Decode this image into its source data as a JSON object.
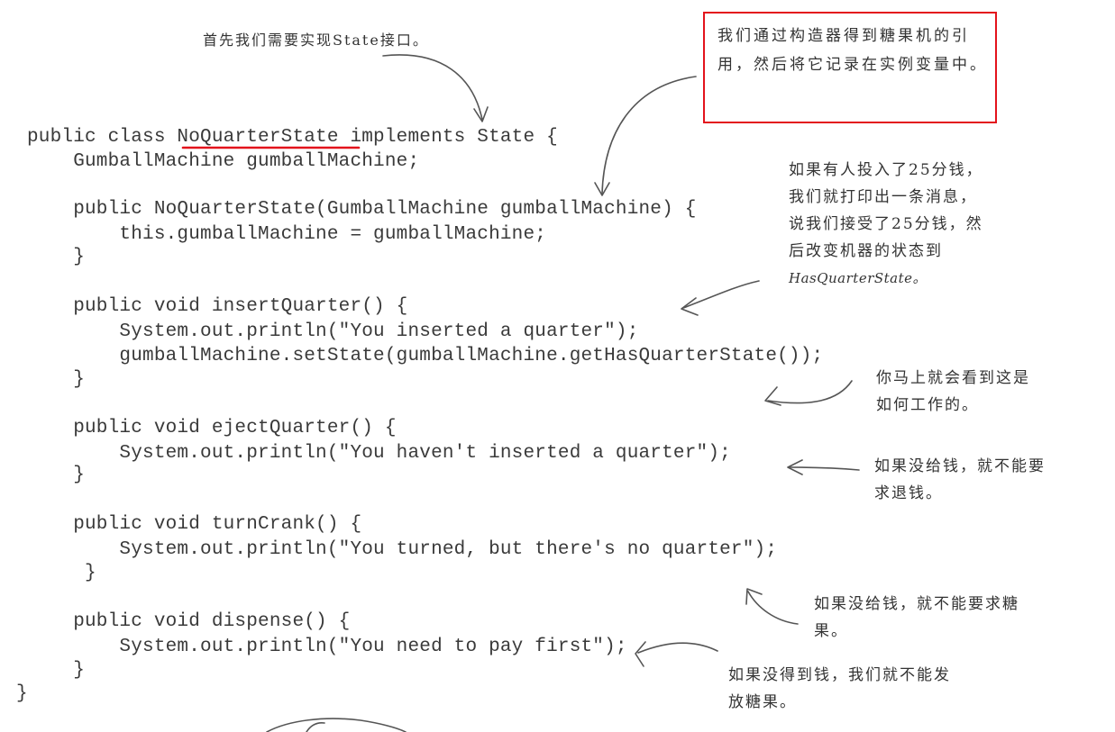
{
  "code": {
    "lines": [
      "public class NoQuarterState implements State {",
      "    GumballMachine gumballMachine;",
      "    public NoQuarterState(GumballMachine gumballMachine) {",
      "        this.gumballMachine = gumballMachine;",
      "    }",
      "    public void insertQuarter() {",
      "        System.out.println(\"You inserted a quarter\");",
      "        gumballMachine.setState(gumballMachine.getHasQuarterState());",
      "    }",
      "    public void ejectQuarter() {",
      "        System.out.println(\"You haven't inserted a quarter\");",
      "    }",
      "    public void turnCrank() {",
      "        System.out.println(\"You turned, but there's no quarter\");",
      "     }",
      "    public void dispense() {",
      "        System.out.println(\"You need to pay first\");",
      "    }",
      "}"
    ]
  },
  "annotations": {
    "implement_state": "首先我们需要实现State接口。",
    "constructor_note": "我们通过构造器得到糖果机的引用，然后将它记录在实例变量中。",
    "insert_note_lines": [
      "如果有人投入了25分钱，",
      "我们就打印出一条消息，",
      "说我们接受了25分钱，然",
      "后改变机器的状态到",
      "HasQuarterState。"
    ],
    "see_how_lines": [
      "你马上就会看到这是",
      "如何工作的。"
    ],
    "eject_note_lines": [
      "如果没给钱，就不能要",
      "求退钱。"
    ],
    "crank_note_lines": [
      "如果没给钱，就不能要求糖",
      "果。"
    ],
    "dispense_note_lines": [
      "如果没得到钱，我们就不能发",
      "放糖果。"
    ]
  },
  "colors": {
    "highlight": "#e3131c",
    "ink": "#333333"
  }
}
